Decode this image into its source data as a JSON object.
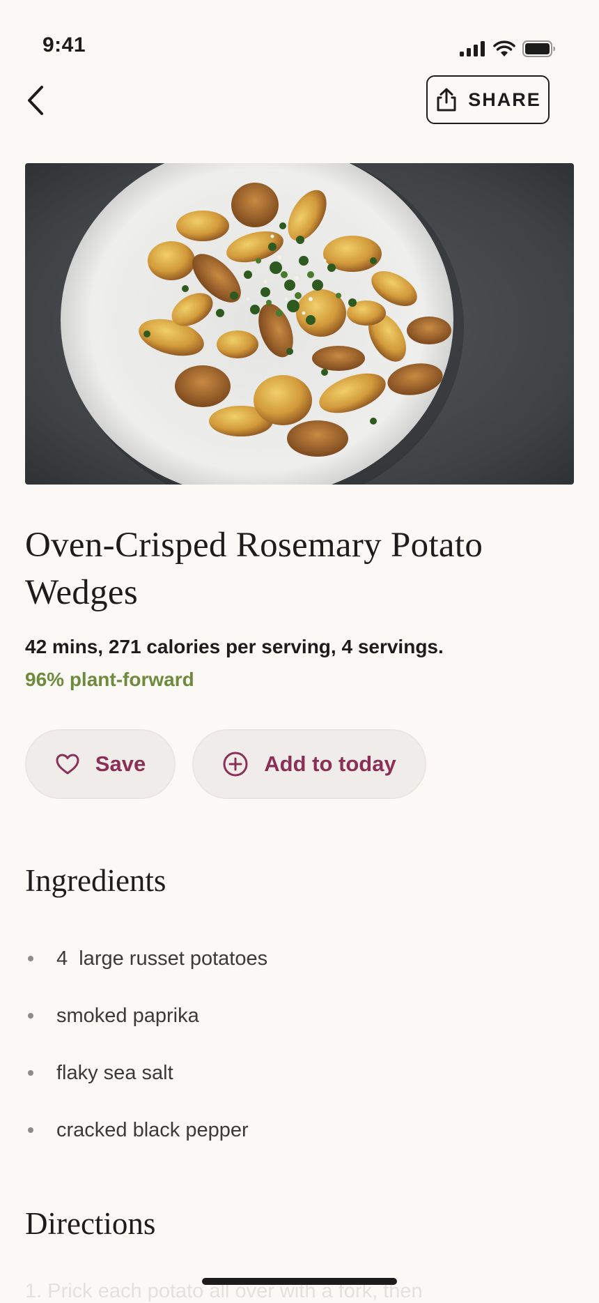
{
  "status_bar": {
    "time": "9:41"
  },
  "header": {
    "share_label": "SHARE"
  },
  "recipe": {
    "title": "Oven-Crisped Rosemary Potato Wedges",
    "meta": "42 mins, 271 calories per serving, 4 servings.",
    "plant_forward": "96% plant-forward",
    "hero_alt": "Roasted potato wedges with herbs on a white plate"
  },
  "actions": {
    "save_label": "Save",
    "add_label": "Add to today"
  },
  "ingredients": {
    "heading": "Ingredients",
    "items": [
      "4  large russet potatoes",
      "smoked paprika",
      "flaky sea salt",
      "cracked black pepper"
    ]
  },
  "directions": {
    "heading": "Directions",
    "first_step_preview": "1.  Prick each potato all over with a fork, then"
  },
  "colors": {
    "accent": "#8a2f55",
    "plant_green": "#6e8b3d",
    "background": "#faf9f6",
    "pill_bg": "#f0ece9"
  }
}
